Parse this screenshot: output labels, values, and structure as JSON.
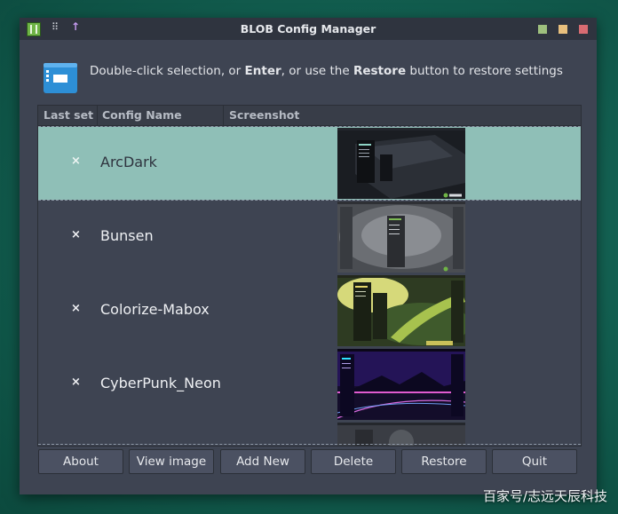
{
  "window": {
    "title": "BLOB Config Manager"
  },
  "info": {
    "text_before": "Double-click selection, or ",
    "enter": "Enter",
    "text_middle": ", or use the ",
    "restore": "Restore",
    "text_after": " button to restore settings"
  },
  "table": {
    "headers": [
      "Last set",
      "Config Name",
      "Screenshot"
    ],
    "rows": [
      {
        "mark": "×",
        "name": "ArcDark",
        "selected": true
      },
      {
        "mark": "×",
        "name": "Bunsen",
        "selected": false
      },
      {
        "mark": "×",
        "name": "Colorize-Mabox",
        "selected": false
      },
      {
        "mark": "×",
        "name": "CyberPunk_Neon",
        "selected": false
      }
    ]
  },
  "buttons": {
    "about": "About",
    "view_image": "View image",
    "add_new": "Add New",
    "delete": "Delete",
    "restore": "Restore",
    "quit": "Quit"
  },
  "icons": {
    "app": "app-menu-icon",
    "grip": "grip-icon",
    "sticky": "arrow-up-icon",
    "info": "info-window-icon",
    "close_mark": "x-icon"
  },
  "colors": {
    "window_bg": "#3e4452",
    "titlebar_bg": "#2f343f",
    "selection": "#8fbfb7",
    "min": "#9ec07e",
    "max": "#e8c07d",
    "close": "#d86c72"
  },
  "watermark": "百家号/志远天辰科技"
}
